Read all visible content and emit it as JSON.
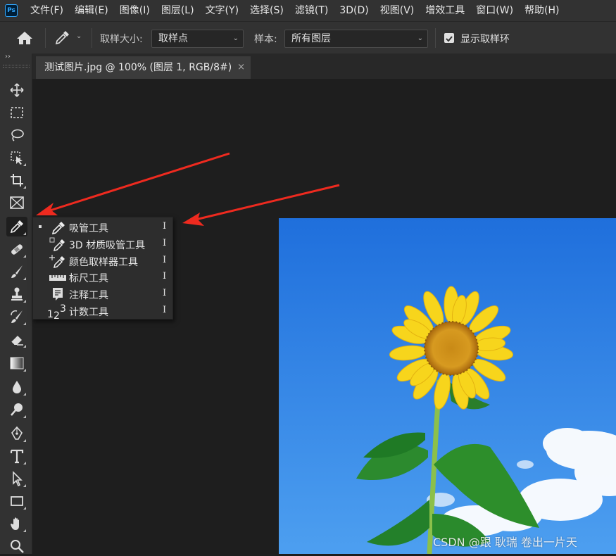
{
  "app": {
    "logo_text": "Ps",
    "menu": [
      "文件(F)",
      "编辑(E)",
      "图像(I)",
      "图层(L)",
      "文字(Y)",
      "选择(S)",
      "滤镜(T)",
      "3D(D)",
      "视图(V)",
      "增效工具",
      "窗口(W)",
      "帮助(H)"
    ]
  },
  "options_bar": {
    "sample_size_label": "取样大小:",
    "sample_size_value": "取样点",
    "sample_label": "样本:",
    "sample_value": "所有图层",
    "show_ring_label": "显示取样环",
    "show_ring_checked": true
  },
  "toolbar": {
    "collapse_glyph": "››"
  },
  "document": {
    "tab_title": "测试图片.jpg @ 100% (图层 1, RGB/8#)",
    "close_glyph": "×"
  },
  "flyout": {
    "items": [
      {
        "label": "吸管工具",
        "shortcut": "I",
        "icon": "eyedropper-icon",
        "selected": true
      },
      {
        "label": "3D 材质吸管工具",
        "shortcut": "I",
        "icon": "3d-material-eyedropper-icon",
        "selected": false
      },
      {
        "label": "颜色取样器工具",
        "shortcut": "I",
        "icon": "color-sampler-icon",
        "selected": false
      },
      {
        "label": "标尺工具",
        "shortcut": "I",
        "icon": "ruler-icon",
        "selected": false
      },
      {
        "label": "注释工具",
        "shortcut": "I",
        "icon": "note-icon",
        "selected": false
      },
      {
        "label": "计数工具",
        "shortcut": "I",
        "icon": "count-icon",
        "selected": false
      }
    ]
  },
  "watermark": "CSDN @跟 耿瑞 卷出一片天",
  "colors": {
    "accent": "#31a8ff",
    "arrow": "#ee2a1f",
    "sky": "#2d86e6"
  }
}
